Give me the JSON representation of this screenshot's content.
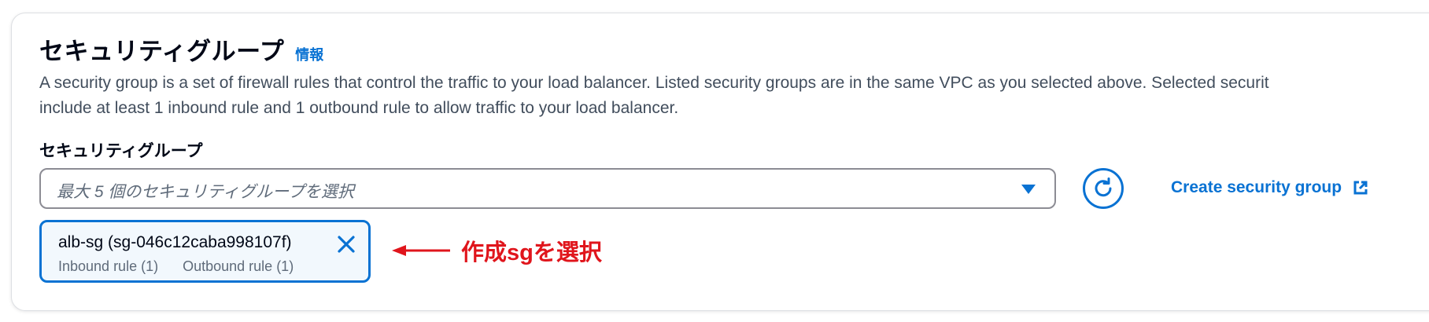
{
  "section": {
    "title": "セキュリティグループ",
    "info_label": "情報",
    "description_line1": "A security group is a set of firewall rules that control the traffic to your load balancer. Listed security groups are in the same VPC as you selected above. Selected securit",
    "description_line2": "include at least 1 inbound rule and 1 outbound rule to allow traffic to your load balancer."
  },
  "field": {
    "label": "セキュリティグループ",
    "placeholder": "最大 5 個のセキュリティグループを選択"
  },
  "create_link": {
    "label": "Create security group"
  },
  "selected_token": {
    "name": "alb-sg (sg-046c12caba998107f)",
    "inbound": "Inbound rule (1)",
    "outbound": "Outbound rule (1)"
  },
  "annotation": {
    "text": "作成sgを選択",
    "color": "#e0151c"
  },
  "colors": {
    "link_blue": "#0972d3",
    "token_bg": "#f2f8fd",
    "border_gray": "#8c8c94"
  },
  "icons": {
    "select_caret": "caret-down-icon",
    "refresh": "refresh-icon",
    "external": "external-link-icon",
    "dismiss": "close-icon",
    "annotation_arrow": "arrow-left-icon"
  }
}
